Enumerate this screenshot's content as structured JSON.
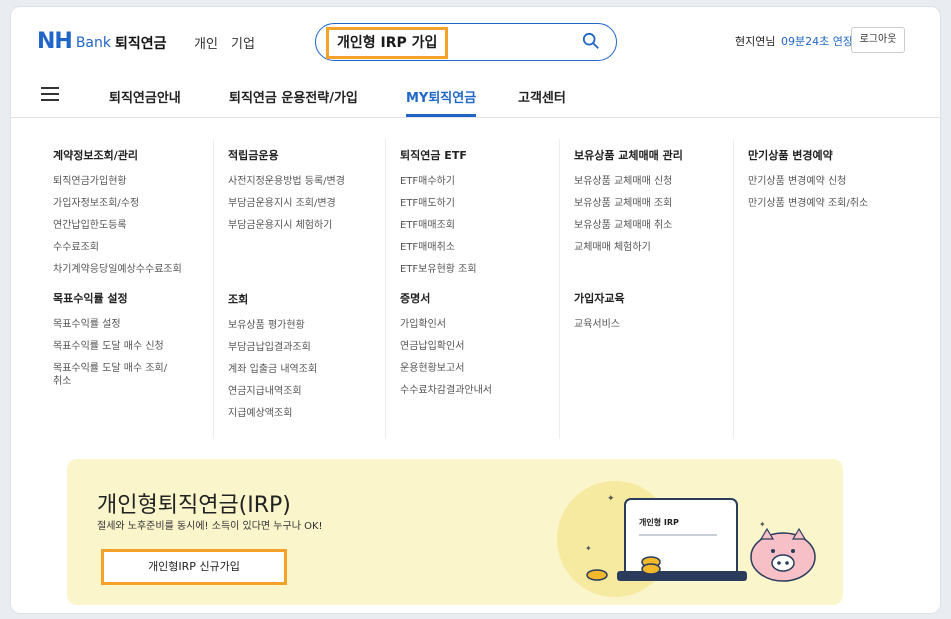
{
  "header": {
    "logo_nh": "NH",
    "logo_bank": "Bank",
    "logo_sub": "퇴직연금",
    "links": [
      "개인",
      "기업"
    ],
    "search_value": "개인형 IRP 가입",
    "user_name": "현지연님",
    "session_timer": "09분24초 연장",
    "logout_label": "로그아웃"
  },
  "nav": {
    "items": [
      "퇴직연금안내",
      "퇴직연금 운용전략/가입",
      "MY퇴직연금",
      "고객센터"
    ],
    "active": "MY퇴직연금"
  },
  "menu": {
    "columns": [
      {
        "groups": [
          {
            "title": "계약정보조회/관리",
            "items": [
              "퇴직연금가입현황",
              "가입자정보조회/수정",
              "연간납입한도등록",
              "수수료조회",
              "차기계약응당일예상수수료조회"
            ]
          },
          {
            "title": "목표수익률 설정",
            "items": [
              "목표수익률 설정",
              "목표수익률 도달 매수 신청",
              "목표수익률 도달 매수 조회/\n취소"
            ]
          }
        ]
      },
      {
        "groups": [
          {
            "title": "적립금운용",
            "items": [
              "사전지정운용방법 등록/변경",
              "부담금운용지시 조회/변경",
              "부담금운용지시 체험하기"
            ]
          },
          {
            "title": "조회",
            "items": [
              "보유상품 평가현황",
              "부담금납입결과조회",
              "계좌 입출금 내역조회",
              "연금지급내역조회",
              "지급예상액조회"
            ]
          }
        ]
      },
      {
        "groups": [
          {
            "title": "퇴직연금 ETF",
            "items": [
              "ETF매수하기",
              "ETF매도하기",
              "ETF매매조회",
              "ETF매매취소",
              "ETF보유현황 조회"
            ]
          },
          {
            "title": "증명서",
            "items": [
              "가입확인서",
              "연금납입확인서",
              "운용현황보고서",
              "수수료차감결과안내서"
            ]
          }
        ]
      },
      {
        "groups": [
          {
            "title": "보유상품 교체매매 관리",
            "items": [
              "보유상품 교체매매 신청",
              "보유상품 교체매매 조회",
              "보유상품 교체매매 취소",
              "교체매매 체험하기"
            ]
          },
          {
            "title": "가입자교육",
            "items": [
              "교육서비스"
            ]
          }
        ]
      },
      {
        "groups": [
          {
            "title": "만기상품 변경예약",
            "items": [
              "만기상품 변경예약 신청",
              "만기상품 변경예약 조회/취소"
            ]
          }
        ]
      }
    ]
  },
  "banner": {
    "title": "개인형퇴직연금(IRP)",
    "subtitle": "절세와 노후준비를 동시에! 소득이 있다면 누구나 OK!",
    "button_label": "개인형IRP 신규가입",
    "card_label": "개인형 IRP"
  },
  "colors": {
    "brand": "#1f66c8",
    "highlight": "#f4a229",
    "banner_bg": "#fbf5cb"
  }
}
